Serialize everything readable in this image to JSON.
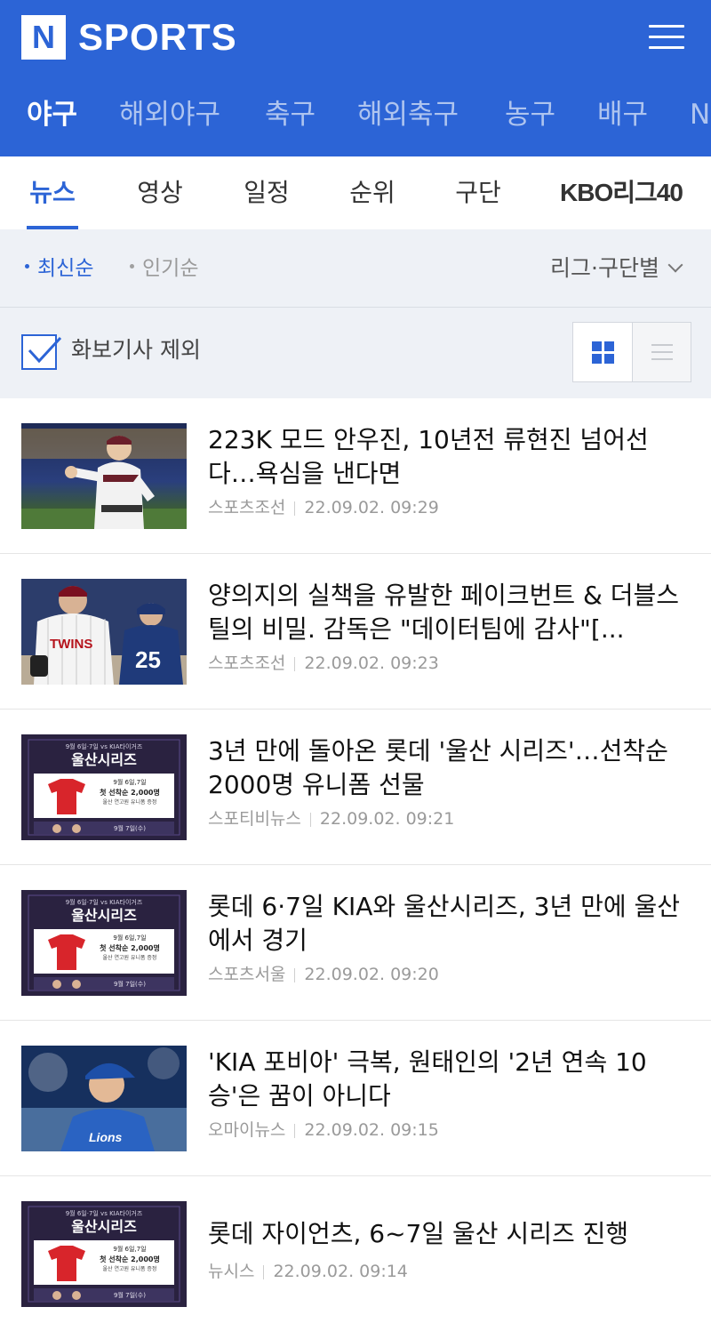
{
  "brand": {
    "logo_letter": "N",
    "name": "SPORTS"
  },
  "sport_tabs": [
    {
      "label": "야구",
      "active": true
    },
    {
      "label": "해외야구"
    },
    {
      "label": "축구"
    },
    {
      "label": "해외축구"
    },
    {
      "label": "농구"
    },
    {
      "label": "배구"
    },
    {
      "label": "N"
    }
  ],
  "sub_tabs": [
    {
      "label": "뉴스",
      "active": true
    },
    {
      "label": "영상"
    },
    {
      "label": "일정"
    },
    {
      "label": "순위"
    },
    {
      "label": "구단"
    },
    {
      "label": "KBO리그40"
    }
  ],
  "sort": {
    "latest": "최신순",
    "popular": "인기순",
    "league_filter": "리그·구단별"
  },
  "filter": {
    "exclude_photo_label": "화보기사 제외",
    "exclude_photo_checked": true
  },
  "colors": {
    "brand_blue": "#2c64d6",
    "promo_red": "#d8252b"
  },
  "promo_thumb": {
    "top_line": "9월 6일·7일 vs KIA타이거즈",
    "title": "울산시리즈",
    "line1": "9월 6일,7일",
    "line2": "첫 선착순 2,000명",
    "line3": "울산 연고원 유니폼 증정",
    "footer": "9월 7일(수)"
  },
  "news": [
    {
      "thumb": "pitcher",
      "title": "223K 모드 안우진, 10년전 류현진 넘어선다…욕심을 낸다면",
      "source": "스포츠조선",
      "time": "22.09.02. 09:29"
    },
    {
      "thumb": "twins",
      "title": "양의지의 실책을 유발한 페이크번트 & 더블스틸의 비밀. 감독은 \"데이터팀에 감사\"[...",
      "source": "스포츠조선",
      "time": "22.09.02. 09:23"
    },
    {
      "thumb": "promo",
      "title": "3년 만에 돌아온 롯데 '울산 시리즈'…선착순 2000명 유니폼 선물",
      "source": "스포티비뉴스",
      "time": "22.09.02. 09:21"
    },
    {
      "thumb": "promo",
      "title": "롯데 6·7일 KIA와 울산시리즈, 3년 만에 울산에서 경기",
      "source": "스포츠서울",
      "time": "22.09.02. 09:20"
    },
    {
      "thumb": "kid",
      "title": "'KIA 포비아' 극복, 원태인의 '2년 연속 10승'은 꿈이 아니다",
      "source": "오마이뉴스",
      "time": "22.09.02. 09:15"
    },
    {
      "thumb": "promo",
      "title": "롯데 자이언츠, 6~7일 울산 시리즈 진행",
      "source": "뉴시스",
      "time": "22.09.02. 09:14"
    }
  ]
}
